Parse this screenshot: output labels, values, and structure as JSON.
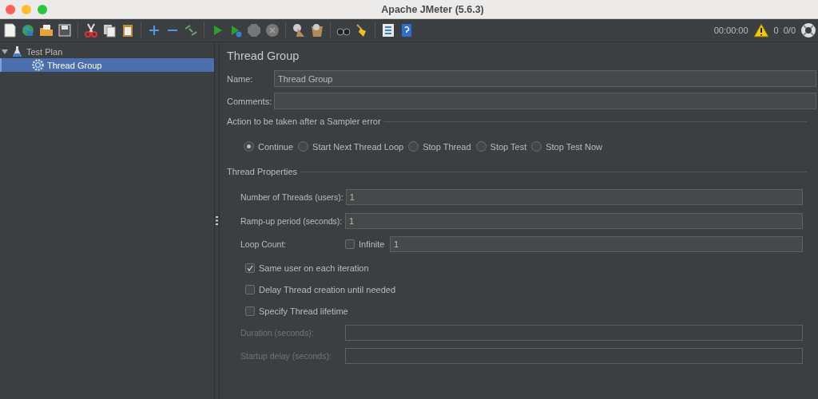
{
  "window": {
    "title": "Apache JMeter (5.6.3)"
  },
  "status": {
    "timer": "00:00:00",
    "error_count": "0",
    "threads": "0/0"
  },
  "tree": [
    {
      "label": "Test Plan",
      "expanded": true,
      "selected": false,
      "children": [
        {
          "label": "Thread Group",
          "selected": true
        }
      ]
    }
  ],
  "panel": {
    "title": "Thread Group",
    "name": {
      "label": "Name:",
      "value": "Thread Group"
    },
    "comments": {
      "label": "Comments:"
    },
    "sampler_error": {
      "title": "Action to be taken after a Sampler error",
      "options": [
        {
          "label": "Continue",
          "selected": true
        },
        {
          "label": "Start Next Thread Loop",
          "selected": false
        },
        {
          "label": "Stop Thread",
          "selected": false
        },
        {
          "label": "Stop Test",
          "selected": false
        },
        {
          "label": "Stop Test Now",
          "selected": false
        }
      ]
    },
    "thread_properties": {
      "title": "Thread Properties",
      "rows": [
        {
          "kind": "field",
          "label": "Number of Threads (users):",
          "value": "1",
          "disabled": false
        },
        {
          "kind": "field",
          "label": "Ramp-up period (seconds):",
          "value": "1",
          "disabled": false
        },
        {
          "kind": "loop",
          "label": "Loop Count:",
          "checkbox_label": "Infinite",
          "checked": false,
          "value": "1"
        },
        {
          "kind": "checkbox",
          "label": "Same user on each iteration",
          "checked": true
        },
        {
          "kind": "checkbox",
          "label": "Delay Thread creation until needed",
          "checked": false
        },
        {
          "kind": "checkbox",
          "label": "Specify Thread lifetime",
          "checked": false
        },
        {
          "kind": "field",
          "label": "Duration (seconds):",
          "disabled": true
        },
        {
          "kind": "field",
          "label": "Startup delay (seconds):",
          "disabled": true
        }
      ]
    }
  }
}
